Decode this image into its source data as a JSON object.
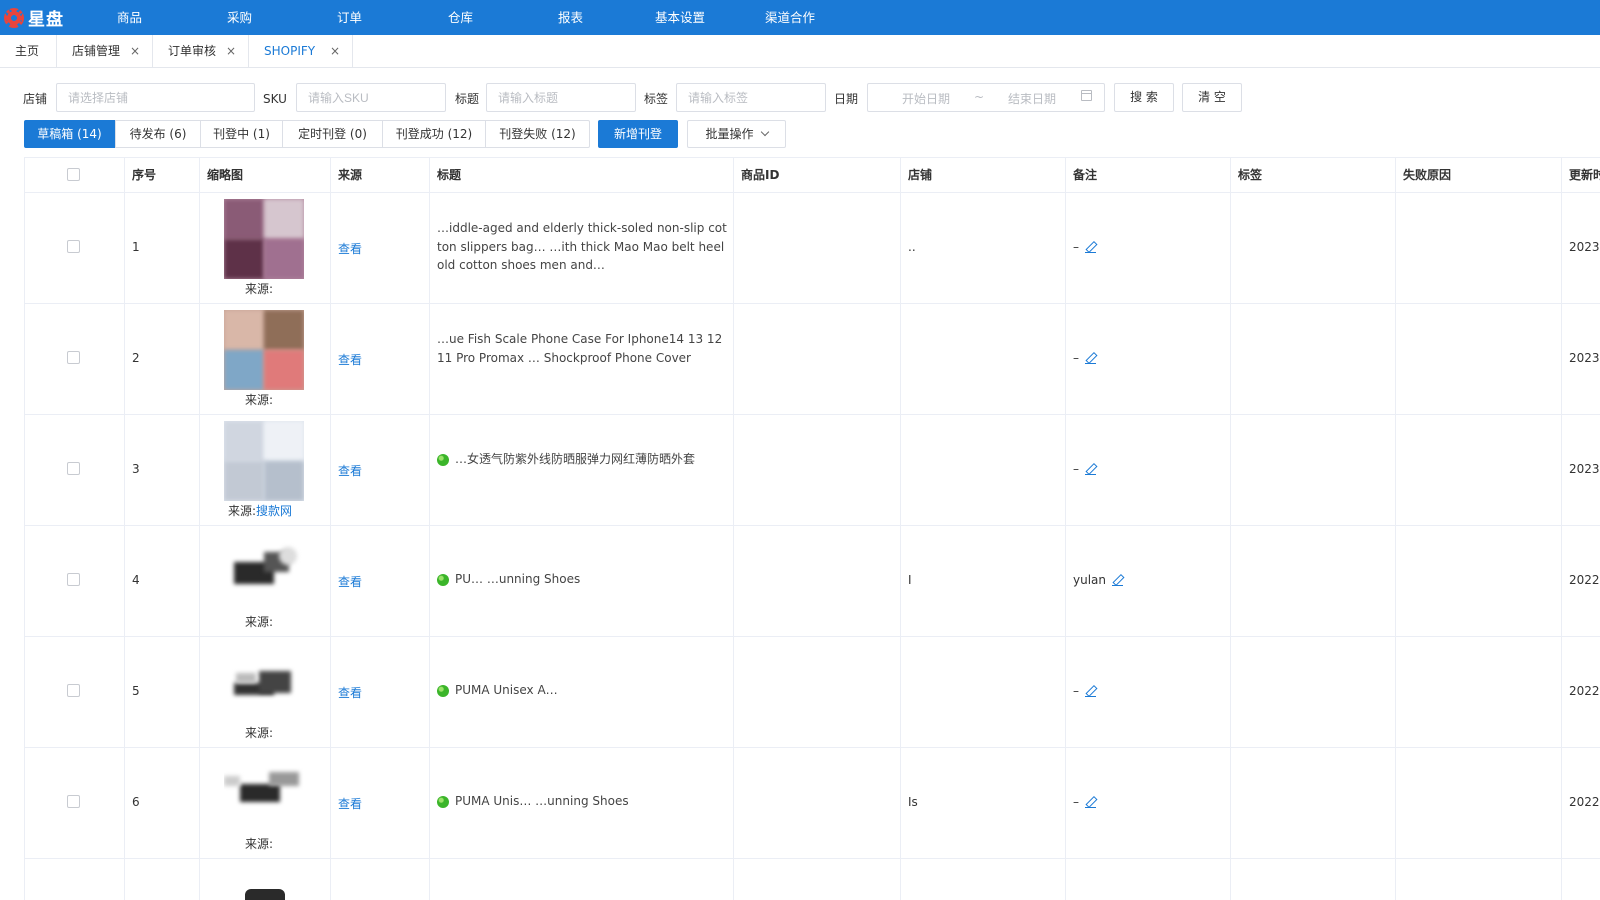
{
  "app": {
    "logo_text": "星盘"
  },
  "nav": [
    "商品",
    "采购",
    "订单",
    "仓库",
    "报表",
    "基本设置",
    "渠道合作"
  ],
  "tabs": [
    {
      "label": "主页",
      "closable": false,
      "active": false
    },
    {
      "label": "店铺管理",
      "closable": true,
      "active": false
    },
    {
      "label": "订单审核",
      "closable": true,
      "active": false
    },
    {
      "label": "SHOPIFY",
      "closable": true,
      "active": true
    }
  ],
  "filters": {
    "shop_label": "店铺",
    "shop_placeholder": "请选择店铺",
    "sku_label": "SKU",
    "sku_placeholder": "请输入SKU",
    "title_label": "标题",
    "title_placeholder": "请输入标题",
    "tag_label": "标签",
    "tag_placeholder": "请输入标签",
    "date_label": "日期",
    "date_start": "开始日期",
    "date_sep": "~",
    "date_end": "结束日期",
    "search_label": "搜 索",
    "clear_label": "清 空"
  },
  "status_tabs": [
    {
      "label": "草稿箱 (14)",
      "active": true
    },
    {
      "label": "待发布 (6)",
      "active": false
    },
    {
      "label": "刊登中 (1)",
      "active": false
    },
    {
      "label": "定时刊登 (0)",
      "active": false
    },
    {
      "label": "刊登成功 (12)",
      "active": false
    },
    {
      "label": "刊登失败 (12)",
      "active": false
    }
  ],
  "actions": {
    "new_listing": "新增刊登",
    "batch": "批量操作"
  },
  "table": {
    "headers": [
      "序号",
      "缩略图",
      "来源",
      "标题",
      "商品ID",
      "店铺",
      "备注",
      "标签",
      "失败原因",
      "更新时"
    ],
    "rows": [
      {
        "no": "1",
        "source_label": "来源:",
        "source_site": "",
        "view": "查看",
        "title": "…iddle-aged and elderly thick-soled non-slip cotton slippers bag… …ith thick Mao Mao belt heel old cotton shoes men and…",
        "has_dot": false,
        "shop": "..",
        "note": "–",
        "updated": "2023-"
      },
      {
        "no": "2",
        "source_label": "来源:",
        "source_site": "",
        "view": "查看",
        "title": "…ue Fish Scale Phone Case For Iphone14 13 12 11 Pro Promax … Shockproof Phone Cover",
        "has_dot": false,
        "shop": "",
        "note": "–",
        "updated": "2023-"
      },
      {
        "no": "3",
        "source_label": "来源:",
        "source_site": "搜款网",
        "view": "查看",
        "title": "…女透气防紫外线防晒服弹力网红薄防晒外套",
        "has_dot": true,
        "shop": "",
        "note": "–",
        "updated": "2023-"
      },
      {
        "no": "4",
        "source_label": "来源:",
        "source_site": "",
        "view": "查看",
        "title": "PU… …unning Shoes",
        "has_dot": true,
        "shop": "I",
        "note": "yulan",
        "updated": "2022-"
      },
      {
        "no": "5",
        "source_label": "来源:",
        "source_site": "",
        "view": "查看",
        "title": "PUMA Unisex A…",
        "has_dot": true,
        "shop": "",
        "note": "–",
        "updated": "2022-"
      },
      {
        "no": "6",
        "source_label": "来源:",
        "source_site": "",
        "view": "查看",
        "title": "PUMA Unis… …unning Shoes",
        "has_dot": true,
        "shop": "Is",
        "note": "–",
        "updated": "2022-"
      }
    ]
  },
  "colors": {
    "primary": "#1b7ad6",
    "link": "#1b7ad6",
    "dot": "#3bb52a"
  }
}
